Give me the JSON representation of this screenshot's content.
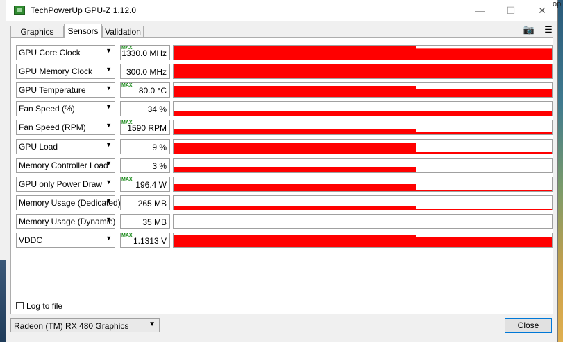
{
  "window": {
    "title": "TechPowerUp GPU-Z 1.12.0"
  },
  "titlebar_buttons": {
    "minimize": "—",
    "maximize": "☐",
    "close": "✕"
  },
  "tabs": [
    {
      "label": "Graphics Card"
    },
    {
      "label": "Sensors"
    },
    {
      "label": "Validation"
    }
  ],
  "active_tab": "Sensors",
  "toolbar": {
    "screenshot_icon": "camera-icon",
    "menu_icon": "hamburger-menu-icon"
  },
  "overlay_text": "op",
  "max_label": "MAX",
  "sensors": [
    {
      "name": "GPU Core Clock",
      "value": "1330.0 MHz",
      "max": true,
      "chart_data": {
        "type": "area",
        "values": [
          1.0,
          0.78
        ]
      }
    },
    {
      "name": "GPU Memory Clock",
      "value": "300.0 MHz",
      "max": false,
      "chart_data": {
        "type": "area",
        "values": [
          1.0,
          1.0
        ]
      }
    },
    {
      "name": "GPU Temperature",
      "value": "80.0 °C",
      "max": true,
      "chart_data": {
        "type": "area",
        "values": [
          0.8,
          0.55
        ]
      }
    },
    {
      "name": "Fan Speed (%)",
      "value": "34 %",
      "max": false,
      "chart_data": {
        "type": "area",
        "values": [
          0.35,
          0.3
        ]
      }
    },
    {
      "name": "Fan Speed (RPM)",
      "value": "1590 RPM",
      "max": true,
      "chart_data": {
        "type": "area",
        "values": [
          0.4,
          0.2
        ]
      }
    },
    {
      "name": "GPU Load",
      "value": "9 %",
      "max": false,
      "chart_data": {
        "type": "area",
        "values": [
          0.75,
          0.1
        ]
      }
    },
    {
      "name": "Memory Controller Load",
      "value": "3 %",
      "max": false,
      "chart_data": {
        "type": "area",
        "values": [
          0.4,
          0.05
        ]
      }
    },
    {
      "name": "GPU only Power Draw",
      "value": "196.4 W",
      "max": true,
      "chart_data": {
        "type": "area",
        "values": [
          0.5,
          0.1
        ]
      }
    },
    {
      "name": "Memory Usage (Dedicated)",
      "value": "265 MB",
      "max": false,
      "chart_data": {
        "type": "area",
        "values": [
          0.3,
          0.05
        ]
      }
    },
    {
      "name": "Memory Usage (Dynamic)",
      "value": "35 MB",
      "max": false,
      "chart_data": {
        "type": "area",
        "values": [
          0.0,
          0.0
        ]
      }
    },
    {
      "name": "VDDC",
      "value": "1.1313 V",
      "max": true,
      "chart_data": {
        "type": "area",
        "values": [
          0.85,
          0.75
        ]
      }
    }
  ],
  "log_to_file": {
    "label": "Log to file",
    "checked": false
  },
  "gpu_select": {
    "value": "Radeon (TM) RX 480 Graphics"
  },
  "close_button": {
    "label": "Close"
  },
  "colors": {
    "graph": "#ff0000",
    "max_tag": "#1a8a1a",
    "accent": "#0078d7"
  }
}
